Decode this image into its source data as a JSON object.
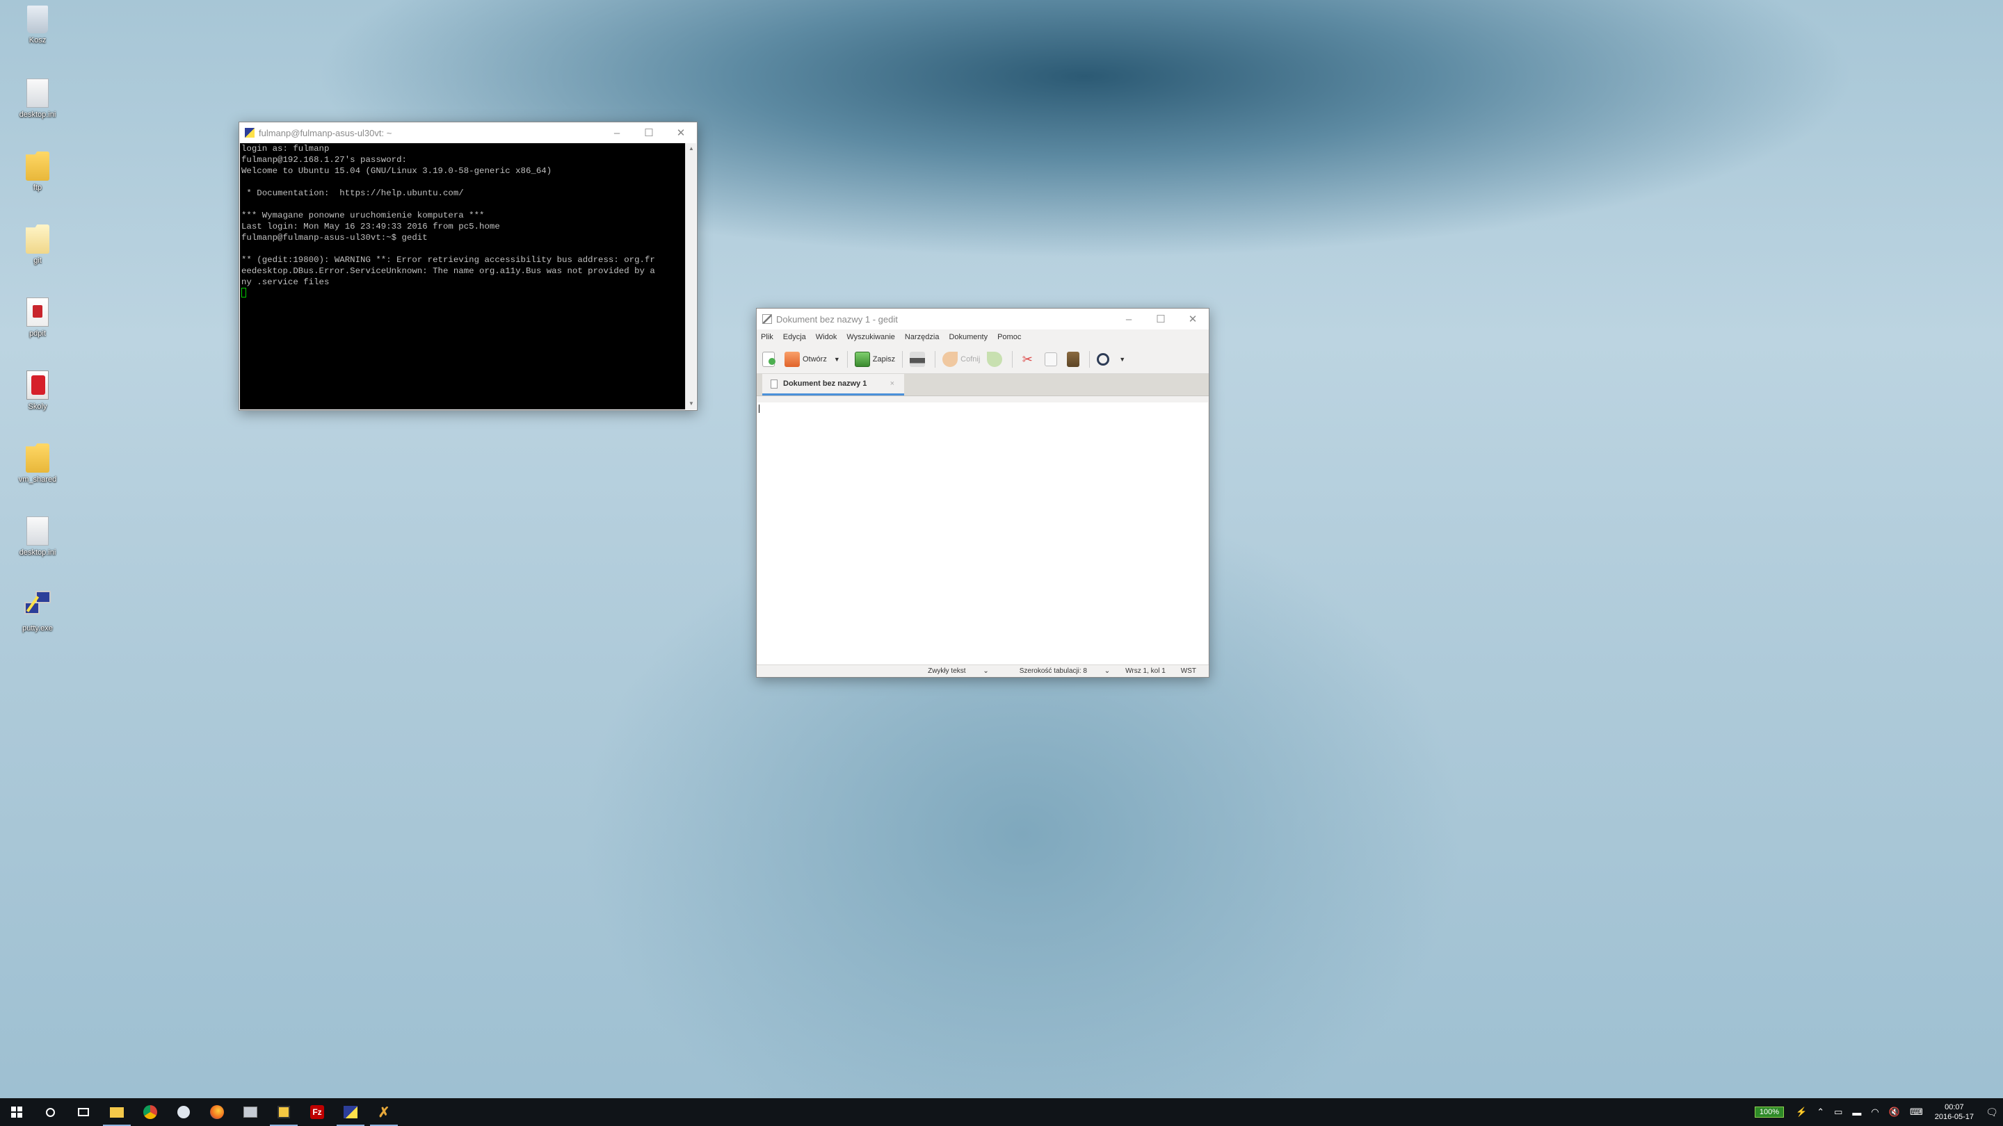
{
  "desktop": {
    "icons": [
      {
        "label": "Kosz",
        "icon": "recycle-bin-icon"
      },
      {
        "label": "desktop.ini",
        "icon": "file-icon"
      },
      {
        "label": "ftp",
        "icon": "folder-icon"
      },
      {
        "label": "git",
        "icon": "folder-icon"
      },
      {
        "label": "pdpit",
        "icon": "pdf-icon"
      },
      {
        "label": "Skoly",
        "icon": "document-icon"
      },
      {
        "label": "vm_shared",
        "icon": "folder-icon"
      },
      {
        "label": "desktop.ini",
        "icon": "file-icon"
      },
      {
        "label": "putty.exe",
        "icon": "putty-icon"
      }
    ]
  },
  "putty": {
    "title": "fulmanp@fulmanp-asus-ul30vt: ~",
    "lines": [
      "login as: fulmanp",
      "fulmanp@192.168.1.27's password:",
      "Welcome to Ubuntu 15.04 (GNU/Linux 3.19.0-58-generic x86_64)",
      "",
      " * Documentation:  https://help.ubuntu.com/",
      "",
      "*** Wymagane ponowne uruchomienie komputera ***",
      "Last login: Mon May 16 23:49:33 2016 from pc5.home",
      "fulmanp@fulmanp-asus-ul30vt:~$ gedit",
      "",
      "** (gedit:19800): WARNING **: Error retrieving accessibility bus address: org.fr",
      "eedesktop.DBus.Error.ServiceUnknown: The name org.a11y.Bus was not provided by a",
      "ny .service files"
    ]
  },
  "gedit": {
    "title": "Dokument bez nazwy 1 - gedit",
    "menu": [
      "Plik",
      "Edycja",
      "Widok",
      "Wyszukiwanie",
      "Narzędzia",
      "Dokumenty",
      "Pomoc"
    ],
    "toolbar": {
      "open": "Otwórz",
      "save": "Zapisz",
      "undo": "Cofnij"
    },
    "tab": {
      "label": "Dokument bez nazwy 1",
      "close": "×"
    },
    "status": {
      "language": "Zwykły tekst",
      "tab_width": "Szerokość tabulacji: 8",
      "position": "Wrsz 1, kol 1",
      "mode": "WST"
    }
  },
  "window_buttons": {
    "minimize": "–",
    "maximize": "☐",
    "close": "✕"
  },
  "taskbar": {
    "battery": "100%",
    "time": "00:07",
    "date": "2016-05-17"
  },
  "colors": {
    "accent": "#4a90d9",
    "taskbar": "#101418",
    "battery": "#2e8a28"
  }
}
